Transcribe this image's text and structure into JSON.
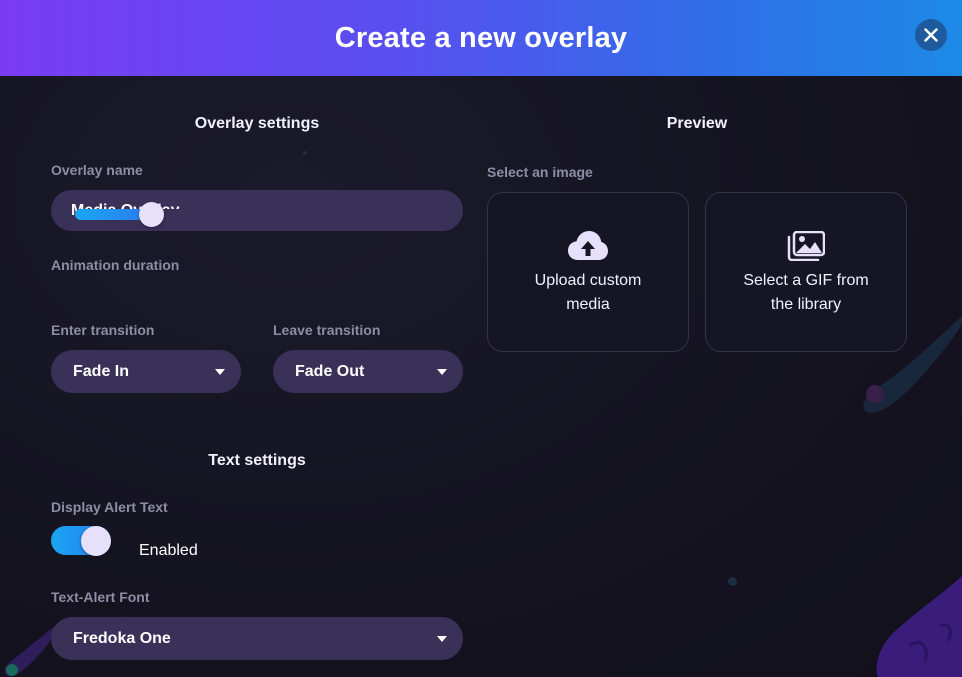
{
  "header": {
    "title": "Create a new overlay"
  },
  "overlay_settings": {
    "title": "Overlay settings",
    "name_label": "Overlay name",
    "name_value": "Media Overlay",
    "animation_label": "Animation duration",
    "animation_value_fraction": 0.2,
    "enter_label": "Enter transition",
    "enter_value": "Fade In",
    "leave_label": "Leave transition",
    "leave_value": "Fade Out"
  },
  "text_settings": {
    "title": "Text settings",
    "display_label": "Display Alert Text",
    "display_enabled": true,
    "display_state_text": "Enabled",
    "font_label": "Text-Alert Font",
    "font_value": "Fredoka One"
  },
  "preview": {
    "title": "Preview",
    "select_label": "Select an image",
    "upload_text": "Upload custom media",
    "gif_text": "Select a GIF from the library"
  },
  "icons": {
    "close": "close-icon",
    "upload": "cloud-upload-icon",
    "gallery": "images-icon",
    "caret": "caret-down-icon"
  },
  "colors": {
    "header_start": "#7a3cf2",
    "header_end": "#1d8ae6",
    "background": "#14131f",
    "pill": "#3a3158",
    "accent": "#1aa6f2"
  }
}
